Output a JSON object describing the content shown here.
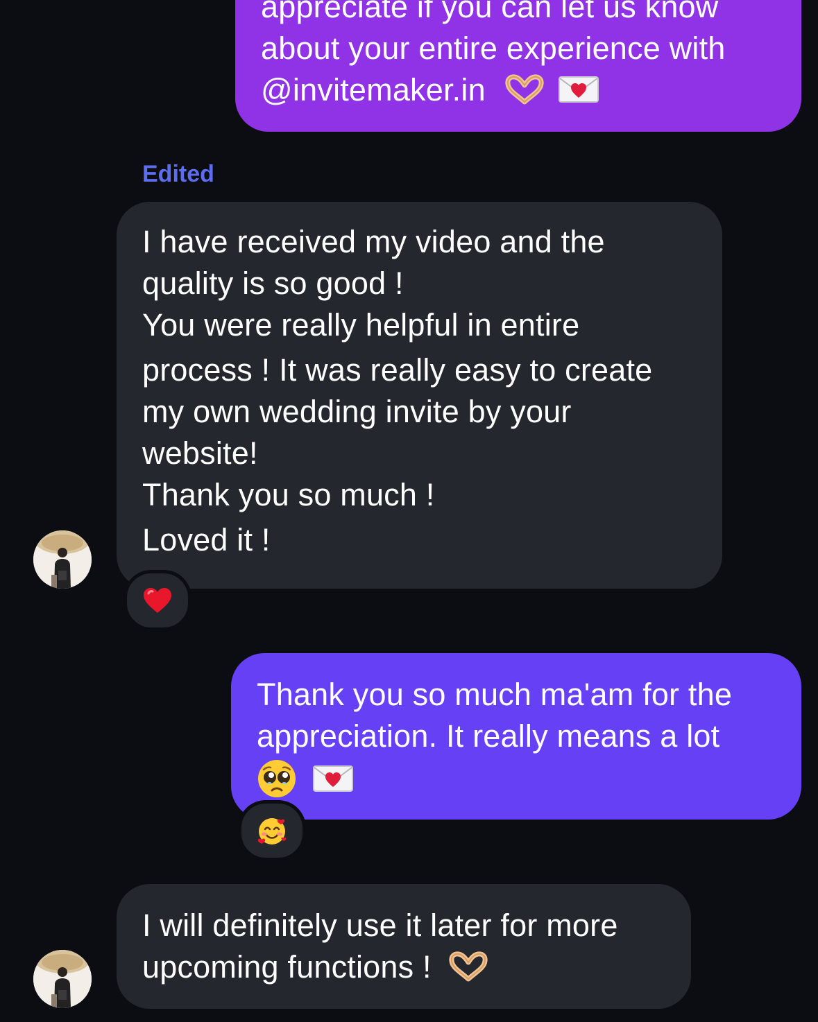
{
  "messages": {
    "sent_top": {
      "lines": [
        "appreciate if you can let us know",
        "about your entire experience with",
        "@invitemaker.in"
      ],
      "emojis": [
        "heart-hands-icon",
        "love-letter-icon"
      ],
      "bg": "#9033e6"
    },
    "edited_label": "Edited",
    "received_1": {
      "lines": [
        "I have received my video and the",
        "quality is so good !",
        "You were really helpful in entire",
        "process ! It was really easy to create",
        "my own wedding invite by your",
        "website!",
        "Thank you so much !",
        "Loved it !"
      ],
      "reaction": "red-heart-icon",
      "bg": "#25272e"
    },
    "sent_2": {
      "lines": [
        "Thank you so much ma'am for the",
        "appreciation. It really means a lot"
      ],
      "emojis": [
        "pleading-face-icon",
        "love-letter-icon"
      ],
      "reaction": "smiling-face-with-hearts-icon",
      "bg": "#6640f5"
    },
    "received_2": {
      "lines": [
        "I will definitely use it later for more",
        "upcoming functions !"
      ],
      "emojis": [
        "heart-hands-icon"
      ],
      "bg": "#25272e"
    }
  },
  "colors": {
    "background": "#0b0d12",
    "edited": "#5c6df0",
    "text": "#ffffff"
  }
}
